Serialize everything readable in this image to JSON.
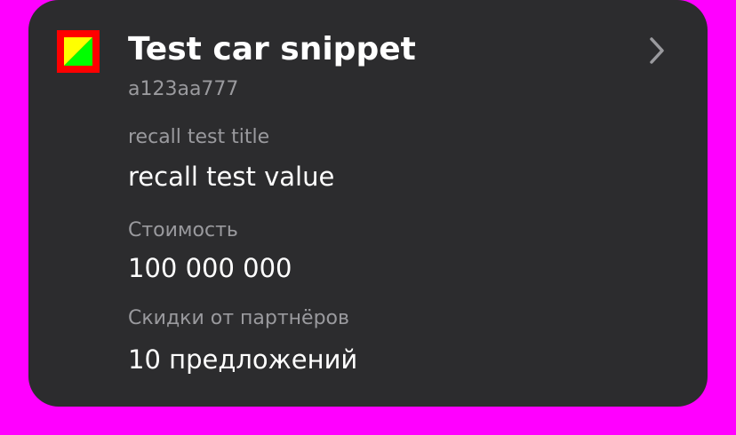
{
  "card": {
    "title": "Test car snippet",
    "subtitle": "a123aa777",
    "thumbnail_icon": "car-thumbnail-icon",
    "chevron_icon": "chevron-right-icon",
    "rows": [
      {
        "label": "recall test title",
        "value": "recall test value"
      },
      {
        "label": "Стоимость",
        "value": "100 000 000"
      },
      {
        "label": "Скидки от партнёров",
        "value": "10 предложений"
      }
    ]
  },
  "colors": {
    "page_background": "#ff00ff",
    "card_background": "#2c2c2e",
    "title_text": "#ffffff",
    "secondary_text": "#9a9a9e",
    "thumb_border": "#ff0000",
    "thumb_green": "#00ff00",
    "thumb_yellow": "#ffff00"
  }
}
